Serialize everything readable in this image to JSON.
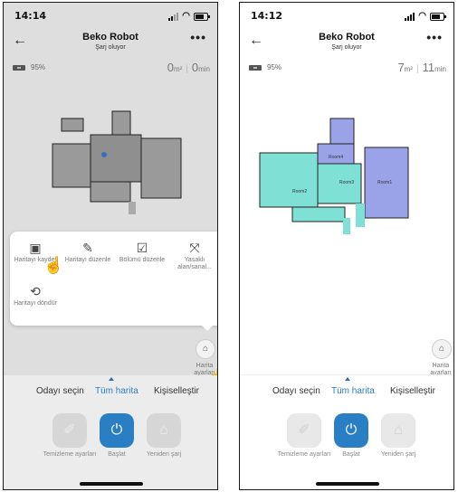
{
  "left": {
    "status_time": "14:14",
    "title": "Beko Robot",
    "subtitle": "Şarj oluyor",
    "battery_pct": "95%",
    "area_value": "0",
    "area_unit": "m²",
    "time_value": "0",
    "time_unit": "min",
    "tools": [
      {
        "icon": "save-map-icon",
        "label": "Haritayı kaydet"
      },
      {
        "icon": "edit-map-icon",
        "label": "Haritayı düzenle"
      },
      {
        "icon": "edit-section-icon",
        "label": "Bölümü düzenle"
      },
      {
        "icon": "forbidden-zone-icon",
        "label": "Yasaklı alan/sanal..."
      },
      {
        "icon": "rotate-map-icon",
        "label": "Haritayı döndür"
      }
    ],
    "map_settings_label": "Harita ayarları",
    "tabs": [
      "Odayı seçin",
      "Tüm harita",
      "Kişiselleştir"
    ],
    "active_tab": "Tüm harita",
    "controls": [
      "Temizleme ayarları",
      "Başlat",
      "Yeniden şarj"
    ]
  },
  "right": {
    "status_time": "14:12",
    "title": "Beko Robot",
    "subtitle": "Şarj oluyor",
    "battery_pct": "95%",
    "area_value": "7",
    "area_unit": "m²",
    "time_value": "11",
    "time_unit": "min",
    "room_labels": [
      "Room4",
      "Room3",
      "Room2",
      "Room1"
    ],
    "map_settings_label": "Harita ayarları",
    "tabs": [
      "Odayı seçin",
      "Tüm harita",
      "Kişiselleştir"
    ],
    "active_tab": "Tüm harita",
    "controls": [
      "Temizleme ayarları",
      "Başlat",
      "Yeniden şarj"
    ]
  },
  "colors": {
    "accent": "#2a7fc4",
    "room_teal": "#7fe0d6",
    "room_purple": "#9aa3e8"
  }
}
